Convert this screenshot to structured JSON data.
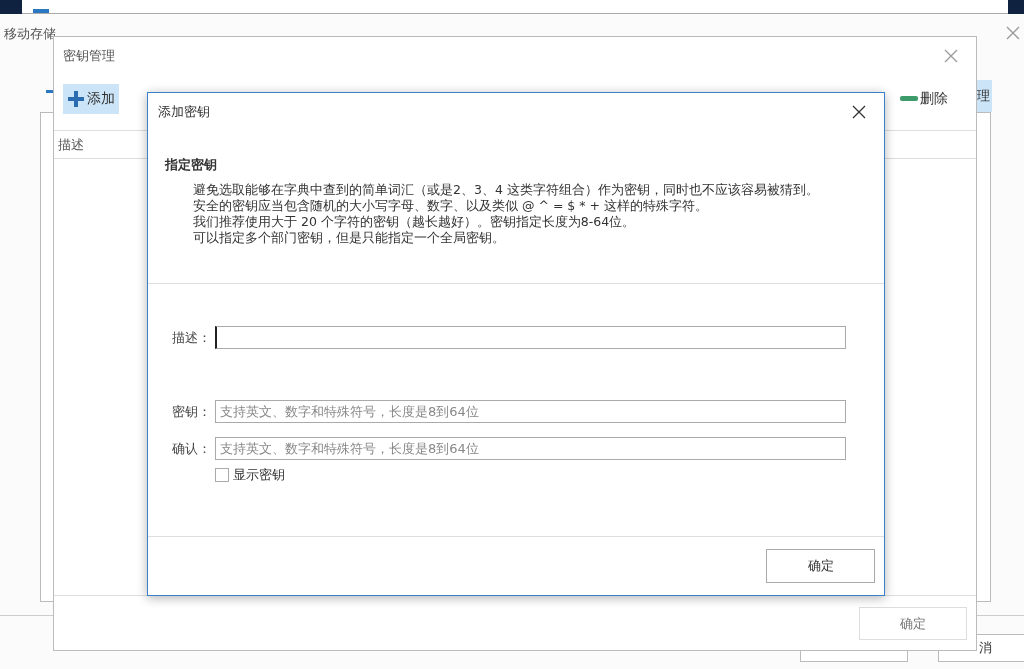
{
  "outer_window": {
    "title": "移动存储",
    "toolbar_fragment": "理",
    "footer_fragment": "消"
  },
  "key_manager": {
    "title": "密钥管理",
    "toolbar": [
      {
        "label": "添加",
        "kind": "add",
        "selected": true
      },
      {
        "label": "删除",
        "kind": "delete",
        "selected": false
      }
    ],
    "table": {
      "columns": [
        "描述"
      ]
    },
    "buttons": [
      "确定"
    ]
  },
  "add_key_dialog": {
    "title": "添加密钥",
    "section_title": "指定密钥",
    "notes": [
      "避免选取能够在字典中查到的简单词汇（或是2、3、4 这类字符组合）作为密钥，同时也不应该容易被猜到。",
      "安全的密钥应当包含随机的大小写字母、数字、以及类似 @ ^ = $ * + 这样的特殊字符。",
      "我们推荐使用大于 20 个字符的密钥（越长越好）。密钥指定长度为8-64位。",
      "可以指定多个部门密钥，但是只能指定一个全局密钥。"
    ],
    "fields": [
      {
        "label": "描述：",
        "focused": true
      },
      {
        "label": "密钥：",
        "placeholder": "支持英文、数字和特殊符号，长度是8到64位",
        "focused": false
      },
      {
        "label": "确认：",
        "placeholder": "支持英文、数字和特殊符号，长度是8到64位",
        "focused": false
      }
    ],
    "show_key": {
      "label": "显示密钥",
      "checked": false
    },
    "buttons": [
      "确定"
    ]
  }
}
